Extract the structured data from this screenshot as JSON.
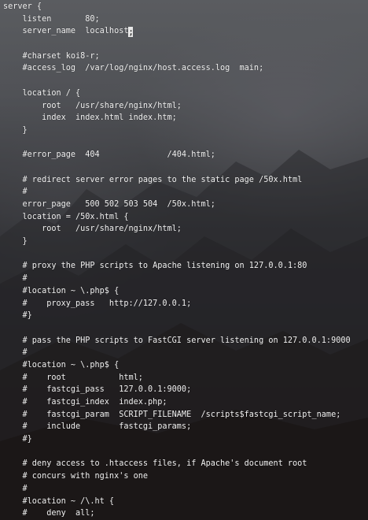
{
  "editor": {
    "cursor_char": ";",
    "lines": [
      "server {",
      "    listen       80;",
      "    server_name  localhost",
      "",
      "    #charset koi8-r;",
      "    #access_log  /var/log/nginx/host.access.log  main;",
      "",
      "    location / {",
      "        root   /usr/share/nginx/html;",
      "        index  index.html index.htm;",
      "    }",
      "",
      "    #error_page  404              /404.html;",
      "",
      "    # redirect server error pages to the static page /50x.html",
      "    #",
      "    error_page   500 502 503 504  /50x.html;",
      "    location = /50x.html {",
      "        root   /usr/share/nginx/html;",
      "    }",
      "",
      "    # proxy the PHP scripts to Apache listening on 127.0.0.1:80",
      "    #",
      "    #location ~ \\.php$ {",
      "    #    proxy_pass   http://127.0.0.1;",
      "    #}",
      "",
      "    # pass the PHP scripts to FastCGI server listening on 127.0.0.1:9000",
      "    #",
      "    #location ~ \\.php$ {",
      "    #    root           html;",
      "    #    fastcgi_pass   127.0.0.1:9000;",
      "    #    fastcgi_index  index.php;",
      "    #    fastcgi_param  SCRIPT_FILENAME  /scripts$fastcgi_script_name;",
      "    #    include        fastcgi_params;",
      "    #}",
      "",
      "    # deny access to .htaccess files, if Apache's document root",
      "    # concurs with nginx's one",
      "    #",
      "    #location ~ /\\.ht {",
      "    #    deny  all;",
      "    #}",
      "}"
    ]
  }
}
